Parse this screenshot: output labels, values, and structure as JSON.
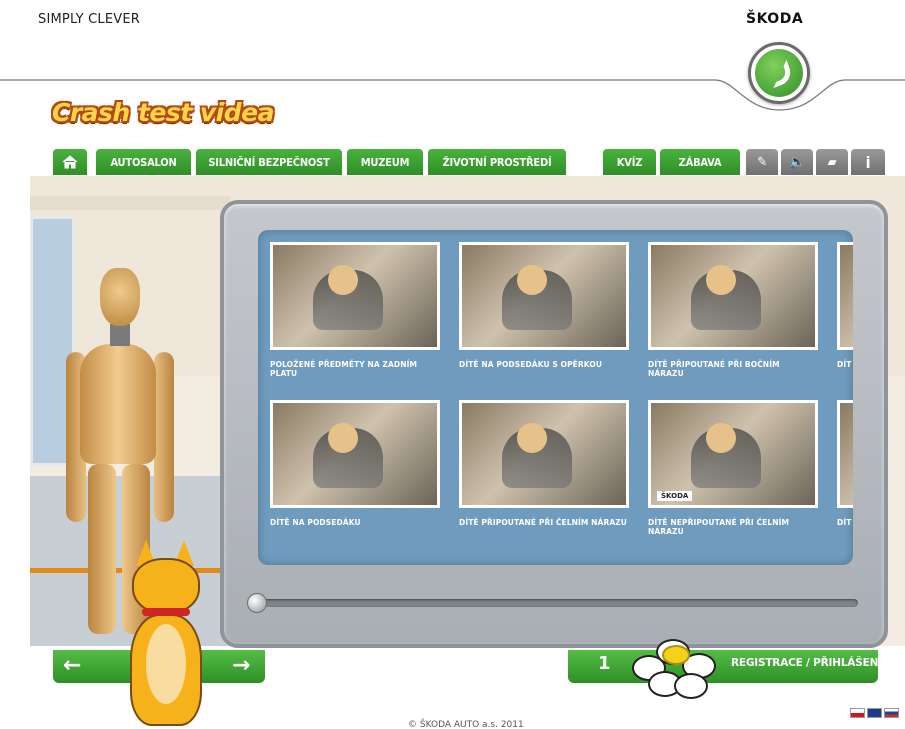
{
  "header": {
    "slogan": "SIMPLY CLEVER",
    "brand": "ŠKODA"
  },
  "site_title": "Crash test videa",
  "nav": {
    "tabs": [
      {
        "label": "AUTOSALON"
      },
      {
        "label": "SILNIČNÍ BEZPEČNOST"
      },
      {
        "label": "MUZEUM"
      },
      {
        "label": "ŽIVOTNÍ PROSTŘEDÍ"
      },
      {
        "label": "KVÍZ"
      },
      {
        "label": "ZÁBAVA"
      }
    ],
    "icons": [
      "home-icon",
      "wrench-icon",
      "sound-icon",
      "chat-icon",
      "info-icon"
    ]
  },
  "videos": [
    {
      "label": "POLOŽENÉ PŘEDMĚTY NA ZADNÍM PLATU"
    },
    {
      "label": "DÍTĚ NA PODSEDÁKU S OPĚRKOU"
    },
    {
      "label": "DÍTĚ PŘIPOUTANÉ PŘI BOČNÍM NÁRAZU"
    },
    {
      "label": "DÍT NÁ"
    },
    {
      "label": "DÍTĚ NA PODSEDÁKU"
    },
    {
      "label": "DÍTĚ PŘIPOUTANÉ PŘI ČELNÍM NÁRAZU"
    },
    {
      "label": "DÍTĚ NEPŘIPOUTANÉ PŘI ČELNÍM NÁRAZU",
      "watermark": "ŠKODA"
    },
    {
      "label": "DÍT NÁ"
    }
  ],
  "footer_nav": {
    "prev_arrow": "←",
    "next_arrow": "→",
    "counter": "1",
    "register_label": "REGISTRACE / PŘIHLÁŠENÍ"
  },
  "copyright": "© ŠKODA AUTO a.s. 2011",
  "languages": [
    "cz",
    "en",
    "ru"
  ],
  "colors": {
    "nav_green": "#3fa233",
    "screen_blue": "#6f9cbe",
    "grey_tab": "#8a8a8a"
  }
}
